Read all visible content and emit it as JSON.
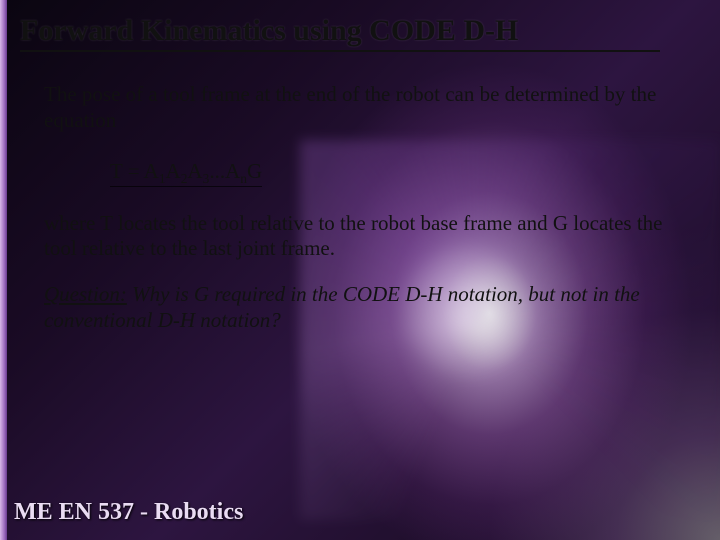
{
  "title": "Forward Kinematics using CODE D-H",
  "para1": "The pose of a tool frame at the end of the robot can be determined by the equation",
  "equation": {
    "lhs": "T = A",
    "s1": "1",
    "a2": "A",
    "s2": "2",
    "a3": "A",
    "s3": "3",
    "dots": "...A",
    "sn": "n",
    "g": "G"
  },
  "para2": "where T locates the tool relative to the robot base frame and G locates the tool relative to the last joint frame.",
  "question_label": "Question:",
  "question_text": " Why is G required in the CODE D-H notation, but not in the conventional D-H notation?",
  "footer": "ME EN 537 - Robotics"
}
